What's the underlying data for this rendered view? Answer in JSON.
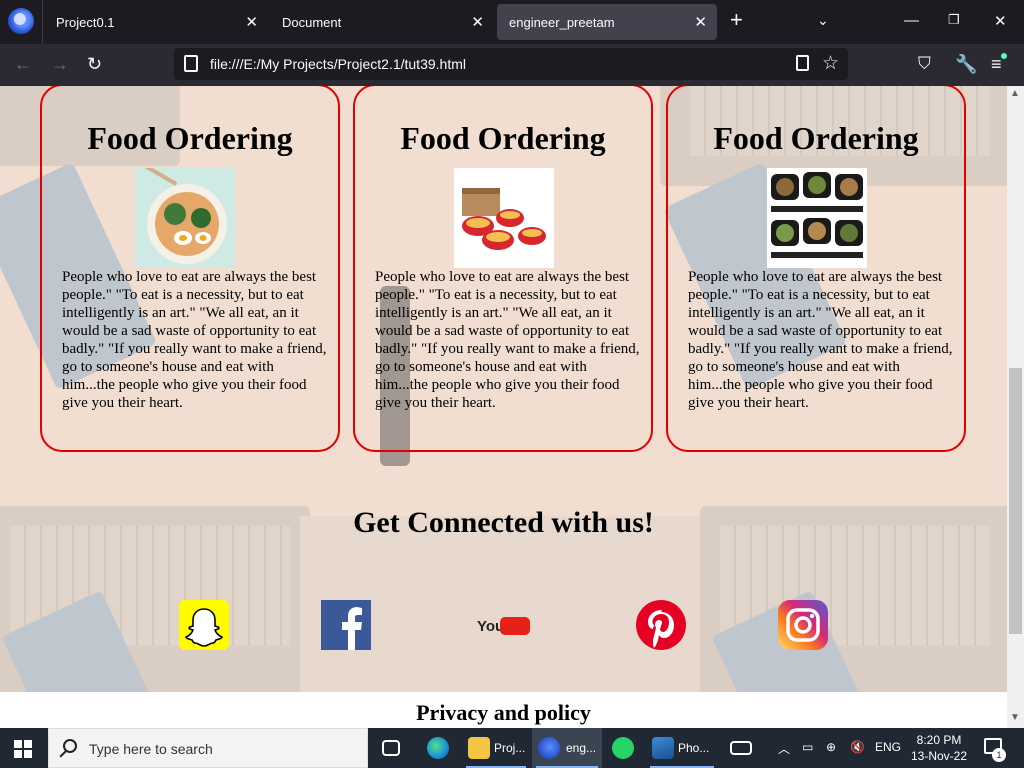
{
  "browser": {
    "tabs": [
      {
        "title": "Project0.1"
      },
      {
        "title": "Document"
      },
      {
        "title": "engineer_preetam"
      }
    ],
    "url": "file:///E:/My Projects/Project2.1/tut39.html"
  },
  "page": {
    "cards": [
      {
        "title": "Food Ordering",
        "image": "ramen-bowl",
        "text": "People who love to eat are always the best people.\" \"To eat is a necessity, but to eat intelligently is an art.\" \"We all eat, an it would be a sad waste of opportunity to eat badly.\" \"If you really want to make a friend, go to someone's house and eat with him...the people who give you their food give you their heart."
      },
      {
        "title": "Food Ordering",
        "image": "meal-boxes",
        "text": "People who love to eat are always the best people.\" \"To eat is a necessity, but to eat intelligently is an art.\" \"We all eat, an it would be a sad waste of opportunity to eat badly.\" \"If you really want to make a friend, go to someone's house and eat with him...the people who give you their food give you their heart."
      },
      {
        "title": "Food Ordering",
        "image": "meal-prep-containers",
        "text": "People who love to eat are always the best people.\" \"To eat is a necessity, but to eat intelligently is an art.\" \"We all eat, an it would be a sad waste of opportunity to eat badly.\" \"If you really want to make a friend, go to someone's house and eat with him...the people who give you their food give you their heart."
      }
    ],
    "connect_title": "Get Connected with us!",
    "social": [
      {
        "name": "snapchat-icon",
        "color": "#fffc00"
      },
      {
        "name": "facebook-icon",
        "color": "#3b5998"
      },
      {
        "name": "youtube-icon",
        "color": "#e62117",
        "logo_text": "YouTube"
      },
      {
        "name": "pinterest-icon",
        "color": "#e60023"
      },
      {
        "name": "instagram-icon",
        "color": "#c13584"
      }
    ],
    "footer": "Privacy and policy"
  },
  "taskbar": {
    "search_placeholder": "Type here to search",
    "items": [
      {
        "label": "Proj..."
      },
      {
        "label": "eng..."
      },
      {
        "label": "Pho..."
      }
    ],
    "language": "ENG",
    "time": "8:20 PM",
    "date": "13-Nov-22",
    "notification_count": "1"
  }
}
